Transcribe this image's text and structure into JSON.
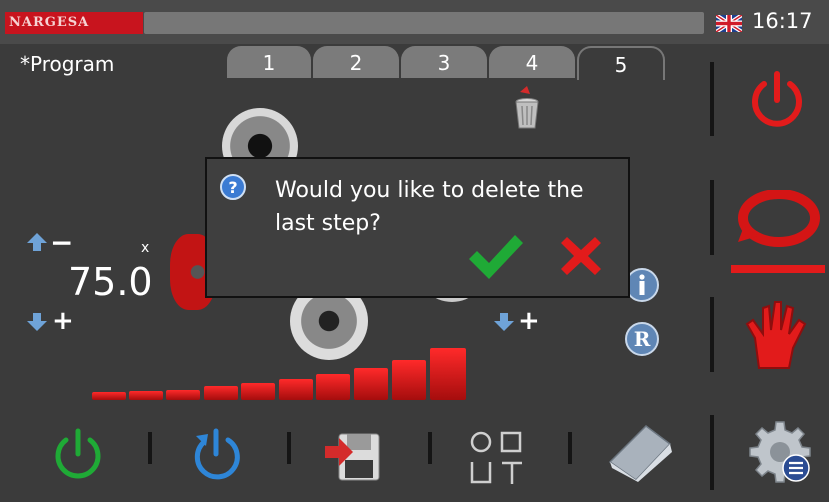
{
  "header": {
    "brand": "NARGESA",
    "language_flag": "uk-flag-icon",
    "clock": "16:17"
  },
  "program": {
    "label": "*Program",
    "tabs": [
      {
        "label": "1",
        "active": false
      },
      {
        "label": "2",
        "active": false
      },
      {
        "label": "3",
        "active": false
      },
      {
        "label": "4",
        "active": false
      },
      {
        "label": "5",
        "active": true
      }
    ]
  },
  "controls": {
    "left_value": "75.0",
    "left_unit": "x",
    "left_minus": "−",
    "left_plus": "+",
    "right_plus": "+"
  },
  "dialog": {
    "message_line1": "Would you like to delete the",
    "message_line2": "last step?",
    "icon": "question-icon",
    "confirm_icon": "check-icon",
    "cancel_icon": "cross-icon"
  },
  "bottom_toolbar": {
    "icons": [
      "power-on-icon",
      "refresh-icon",
      "save-icon",
      "shapes-icon",
      "folder-icon",
      "settings-icon"
    ]
  },
  "right_panel": {
    "icons": [
      "power-off-icon",
      "cycle-icon",
      "manual-hand-icon"
    ]
  },
  "side_icons": [
    "info-icon",
    "reset-icon",
    "trash-icon"
  ],
  "colors": {
    "accent_red": "#e21b1b",
    "confirm_green": "#1faa36",
    "power_blue": "#2e86d8",
    "power_green": "#1faa36"
  }
}
